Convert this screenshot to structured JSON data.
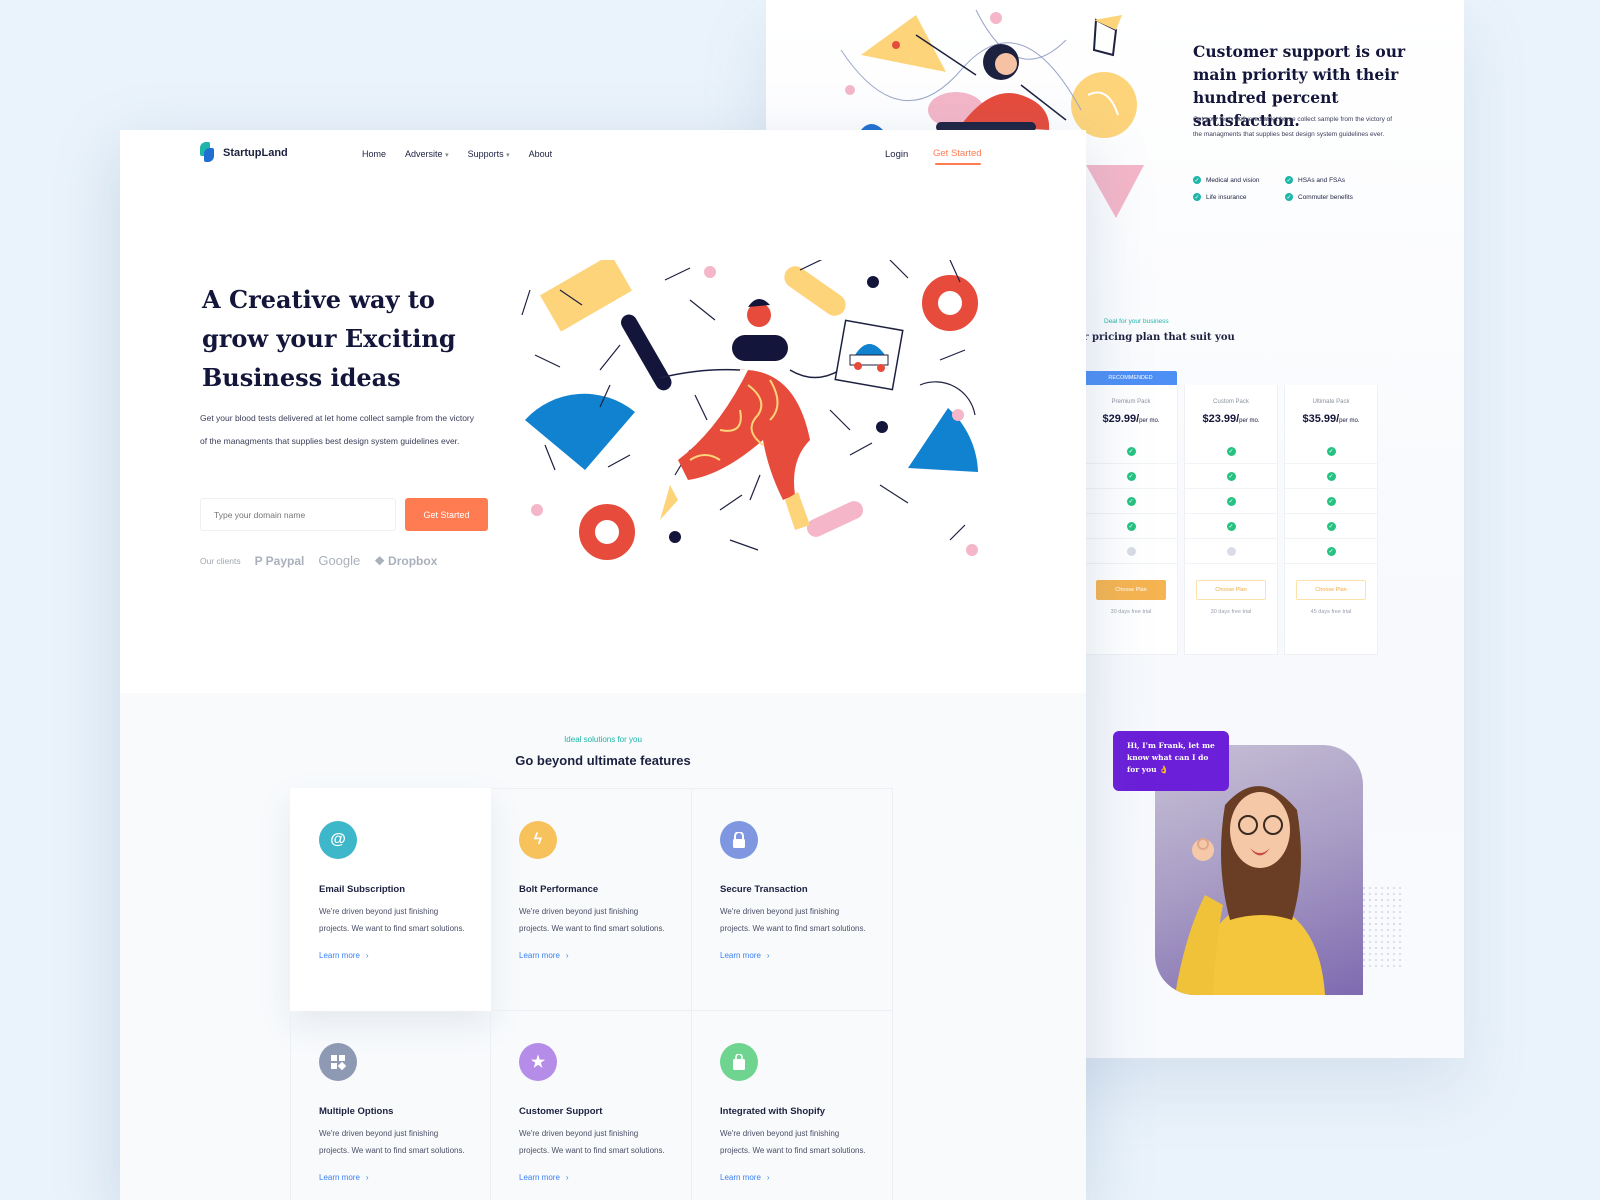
{
  "back_page": {
    "title": "Customer support is our main priority with their hundred percent satisfaction.",
    "description": "Get your tests delivered at let home collect sample from the victory of the managments that supplies best design system guidelines ever.",
    "benefits": [
      "Medical and vision",
      "HSAs and FSAs",
      "Life insurance",
      "Commuter benefits"
    ],
    "pricing": {
      "kicker": "Deal for your business",
      "heading": "ur pricing plan that suit you",
      "recommended_label": "RECOMMENDED",
      "plans": [
        {
          "name": "Premium Pack",
          "price": "$29.99/",
          "period": "per mo.",
          "features": [
            true,
            true,
            true,
            true,
            false
          ],
          "button": "Choose Plan",
          "trial": "30 days free trial"
        },
        {
          "name": "Custom Pack",
          "price": "$23.99/",
          "period": "per mo.",
          "features": [
            true,
            true,
            true,
            true,
            false
          ],
          "button": "Choose Plan",
          "trial": "30 days free trial"
        },
        {
          "name": "Ultimate Pack",
          "price": "$35.99/",
          "period": "per mo.",
          "features": [
            true,
            true,
            true,
            true,
            true
          ],
          "button": "Choose Plan",
          "trial": "45 days free trial"
        }
      ]
    },
    "chat_bubble": "Hi, I'm Frank, let me know what can I do for you 👌"
  },
  "front_page": {
    "brand": "StartupLand",
    "nav": [
      {
        "label": "Home",
        "caret": false
      },
      {
        "label": "Adversite",
        "caret": true
      },
      {
        "label": "Supports",
        "caret": true
      },
      {
        "label": "About",
        "caret": false
      }
    ],
    "login": "Login",
    "cta": "Get Started",
    "hero": {
      "title": "A Creative way to grow your Exciting Business ideas",
      "description": "Get your blood tests delivered at let home collect sample from the victory of the managments that supplies best design system guidelines ever.",
      "input_placeholder": "Type your domain name",
      "button": "Get Started",
      "clients_label": "Our clients",
      "clients": [
        "Paypal",
        "Google",
        "Dropbox"
      ]
    },
    "features": {
      "kicker": "Ideal solutions for you",
      "title": "Go beyond ultimate features",
      "cards": [
        {
          "icon": "at-icon",
          "glyph": "@",
          "color": "#3db7c9",
          "title": "Email Subscription",
          "text": "We're driven beyond just finishing projects. We want to find smart solutions.",
          "link": "Learn more"
        },
        {
          "icon": "bolt-icon",
          "glyph": "⚡",
          "color": "#f7c15c",
          "title": "Bolt Performance",
          "text": "We're driven beyond just finishing projects. We want to find smart solutions.",
          "link": "Learn more"
        },
        {
          "icon": "lock-icon",
          "glyph": "🔒",
          "color": "#7e97e0",
          "title": "Secure Transaction",
          "text": "We're driven beyond just finishing projects. We want to find smart solutions.",
          "link": "Learn more"
        },
        {
          "icon": "options-icon",
          "glyph": "▦",
          "color": "#8e9ab3",
          "title": "Multiple Options",
          "text": "We're driven beyond just finishing projects. We want to find smart solutions.",
          "link": "Learn more"
        },
        {
          "icon": "star-icon",
          "glyph": "★",
          "color": "#b58ce8",
          "title": "Customer Support",
          "text": "We're driven beyond just finishing projects. We want to find smart solutions.",
          "link": "Learn more"
        },
        {
          "icon": "shopping-bag-icon",
          "glyph": "🛍",
          "color": "#6fd490",
          "title": "Integrated with Shopify",
          "text": "We're driven beyond just finishing projects. We want to find smart solutions.",
          "link": "Learn more"
        }
      ]
    }
  },
  "colors": {
    "accent": "#ff7b52",
    "teal": "#1fb5a8",
    "link": "#3c82f6",
    "dark": "#13163a"
  }
}
